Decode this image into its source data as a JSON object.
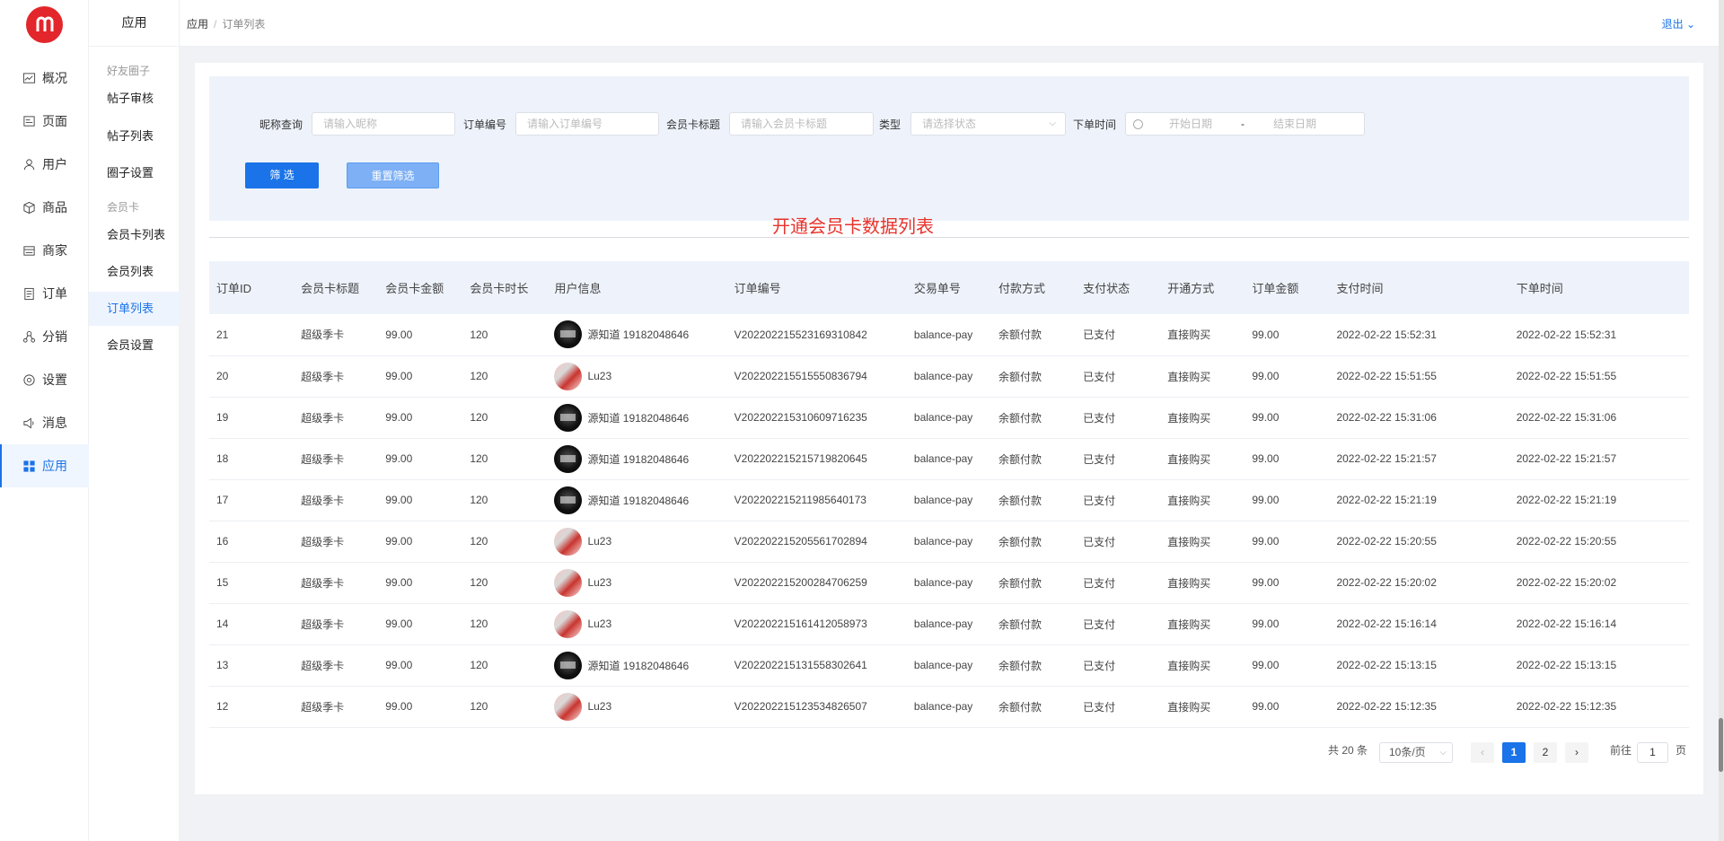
{
  "nav": {
    "items": [
      {
        "label": "概况",
        "icon": "chart-icon"
      },
      {
        "label": "页面",
        "icon": "page-icon"
      },
      {
        "label": "用户",
        "icon": "user-icon"
      },
      {
        "label": "商品",
        "icon": "box-icon"
      },
      {
        "label": "商家",
        "icon": "store-icon"
      },
      {
        "label": "订单",
        "icon": "order-icon"
      },
      {
        "label": "分销",
        "icon": "distribution-icon"
      },
      {
        "label": "设置",
        "icon": "settings-icon"
      },
      {
        "label": "消息",
        "icon": "message-icon"
      },
      {
        "label": "应用",
        "icon": "apps-icon"
      }
    ]
  },
  "subnav": {
    "title": "应用",
    "group1": "好友圈子",
    "group1_items": [
      "帖子审核",
      "帖子列表",
      "圈子设置"
    ],
    "group2": "会员卡",
    "group2_items": [
      "会员卡列表",
      "会员列表",
      "订单列表",
      "会员设置"
    ]
  },
  "header": {
    "breadcrumb_root": "应用",
    "breadcrumb_sep": "/",
    "breadcrumb_current": "订单列表",
    "logout": "退出"
  },
  "filters": {
    "nickname_label": "昵称查询",
    "nickname_placeholder": "请输入昵称",
    "order_no_label": "订单编号",
    "order_no_placeholder": "请输入订单编号",
    "card_title_label": "会员卡标题",
    "card_title_placeholder": "请输入会员卡标题",
    "type_label": "类型",
    "type_placeholder": "请选择状态",
    "date_label": "下单时间",
    "start_placeholder": "开始日期",
    "date_sep": "-",
    "end_placeholder": "结束日期",
    "filter_button": "筛 选",
    "reset_button": "重置筛选"
  },
  "overlay_title": "开通会员卡数据列表",
  "table": {
    "columns": [
      "订单ID",
      "会员卡标题",
      "会员卡金额",
      "会员卡时长",
      "用户信息",
      "订单编号",
      "交易单号",
      "付款方式",
      "支付状态",
      "开通方式",
      "订单金额",
      "支付时间",
      "下单时间"
    ],
    "rows": [
      {
        "id": "21",
        "title": "超级季卡",
        "amount": "99.00",
        "duration": "120",
        "avatar": "dark",
        "user": "源知道 19182048646",
        "order_no": "V202202215523169310842",
        "trade_no": "balance-pay",
        "pay_method": "余额付款",
        "pay_status": "已支付",
        "open_method": "直接购买",
        "order_amount": "99.00",
        "pay_time": "2022-02-22 15:52:31",
        "order_time": "2022-02-22 15:52:31"
      },
      {
        "id": "20",
        "title": "超级季卡",
        "amount": "99.00",
        "duration": "120",
        "avatar": "red",
        "user": "Lu23",
        "order_no": "V202202215515550836794",
        "trade_no": "balance-pay",
        "pay_method": "余额付款",
        "pay_status": "已支付",
        "open_method": "直接购买",
        "order_amount": "99.00",
        "pay_time": "2022-02-22 15:51:55",
        "order_time": "2022-02-22 15:51:55"
      },
      {
        "id": "19",
        "title": "超级季卡",
        "amount": "99.00",
        "duration": "120",
        "avatar": "dark",
        "user": "源知道 19182048646",
        "order_no": "V202202215310609716235",
        "trade_no": "balance-pay",
        "pay_method": "余额付款",
        "pay_status": "已支付",
        "open_method": "直接购买",
        "order_amount": "99.00",
        "pay_time": "2022-02-22 15:31:06",
        "order_time": "2022-02-22 15:31:06"
      },
      {
        "id": "18",
        "title": "超级季卡",
        "amount": "99.00",
        "duration": "120",
        "avatar": "dark",
        "user": "源知道 19182048646",
        "order_no": "V202202215215719820645",
        "trade_no": "balance-pay",
        "pay_method": "余额付款",
        "pay_status": "已支付",
        "open_method": "直接购买",
        "order_amount": "99.00",
        "pay_time": "2022-02-22 15:21:57",
        "order_time": "2022-02-22 15:21:57"
      },
      {
        "id": "17",
        "title": "超级季卡",
        "amount": "99.00",
        "duration": "120",
        "avatar": "dark",
        "user": "源知道 19182048646",
        "order_no": "V202202215211985640173",
        "trade_no": "balance-pay",
        "pay_method": "余额付款",
        "pay_status": "已支付",
        "open_method": "直接购买",
        "order_amount": "99.00",
        "pay_time": "2022-02-22 15:21:19",
        "order_time": "2022-02-22 15:21:19"
      },
      {
        "id": "16",
        "title": "超级季卡",
        "amount": "99.00",
        "duration": "120",
        "avatar": "red",
        "user": "Lu23",
        "order_no": "V202202215205561702894",
        "trade_no": "balance-pay",
        "pay_method": "余额付款",
        "pay_status": "已支付",
        "open_method": "直接购买",
        "order_amount": "99.00",
        "pay_time": "2022-02-22 15:20:55",
        "order_time": "2022-02-22 15:20:55"
      },
      {
        "id": "15",
        "title": "超级季卡",
        "amount": "99.00",
        "duration": "120",
        "avatar": "red",
        "user": "Lu23",
        "order_no": "V202202215200284706259",
        "trade_no": "balance-pay",
        "pay_method": "余额付款",
        "pay_status": "已支付",
        "open_method": "直接购买",
        "order_amount": "99.00",
        "pay_time": "2022-02-22 15:20:02",
        "order_time": "2022-02-22 15:20:02"
      },
      {
        "id": "14",
        "title": "超级季卡",
        "amount": "99.00",
        "duration": "120",
        "avatar": "red",
        "user": "Lu23",
        "order_no": "V202202215161412058973",
        "trade_no": "balance-pay",
        "pay_method": "余额付款",
        "pay_status": "已支付",
        "open_method": "直接购买",
        "order_amount": "99.00",
        "pay_time": "2022-02-22 15:16:14",
        "order_time": "2022-02-22 15:16:14"
      },
      {
        "id": "13",
        "title": "超级季卡",
        "amount": "99.00",
        "duration": "120",
        "avatar": "dark",
        "user": "源知道 19182048646",
        "order_no": "V202202215131558302641",
        "trade_no": "balance-pay",
        "pay_method": "余额付款",
        "pay_status": "已支付",
        "open_method": "直接购买",
        "order_amount": "99.00",
        "pay_time": "2022-02-22 15:13:15",
        "order_time": "2022-02-22 15:13:15"
      },
      {
        "id": "12",
        "title": "超级季卡",
        "amount": "99.00",
        "duration": "120",
        "avatar": "red",
        "user": "Lu23",
        "order_no": "V202202215123534826507",
        "trade_no": "balance-pay",
        "pay_method": "余额付款",
        "pay_status": "已支付",
        "open_method": "直接购买",
        "order_amount": "99.00",
        "pay_time": "2022-02-22 15:12:35",
        "order_time": "2022-02-22 15:12:35"
      }
    ]
  },
  "pagination": {
    "total": "共 20 条",
    "page_size": "10条/页",
    "pages": [
      "1",
      "2"
    ],
    "current_page": "1",
    "prev": "‹",
    "next": "›",
    "goto_label": "前往",
    "goto_value": "1",
    "page_suffix": "页"
  },
  "colors": {
    "accent": "#1a73e8",
    "logo": "#e3262b",
    "overlay_title": "#e7332c"
  }
}
